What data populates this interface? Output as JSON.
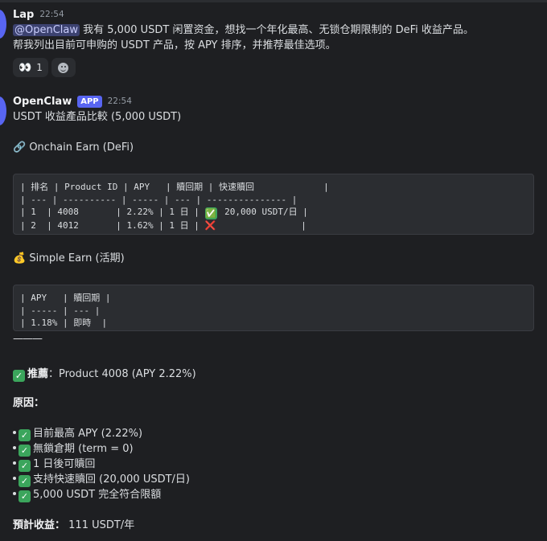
{
  "message1": {
    "author": "Lap",
    "time": "22:54",
    "mention": "@OpenClaw",
    "line1": " 我有 5,000 USDT 闲置资金，想找一个年化最高、无锁仓期限制的 DeFi 收益产品。",
    "line2": "帮我列出目前可申购的 USDT 产品，按 APY 排序，并推荐最佳选项。",
    "reactions": [
      {
        "icon": "eyes-emoji",
        "glyph": "👀",
        "count": "1"
      },
      {
        "icon": "add-reaction-icon"
      }
    ]
  },
  "message2": {
    "author": "OpenClaw",
    "badge": "APP",
    "time": "22:54",
    "heading": "USDT 收益產品比較 (5,000 USDT)",
    "section1": {
      "icon": "link-icon",
      "glyph": "🔗",
      "title": "Onchain Earn (DeFi)"
    },
    "table1": {
      "header": "| 排名 | Product ID | APY   | 贖回期 | 快速贖回             |",
      "sep": "| --- | ---------- | ----- | --- | --------------- |",
      "rows": [
        {
          "left": "| 1  | 4008       | 2.22% | 1 日 | ",
          "mark": "✅",
          "right": " 20,000 USDT/日 |"
        },
        {
          "left": "| 2  | 4012       | 1.62% | 1 日 | ",
          "mark": "❌",
          "right": "                |"
        }
      ]
    },
    "section2": {
      "icon": "money-bag-icon",
      "glyph": "💰",
      "title": "Simple Earn (活期)"
    },
    "table2": {
      "header": "| APY   | 贖回期 |",
      "sep": "| ----- | --- |",
      "row": "| 1.18% | 即時  |"
    },
    "divider": "———",
    "recommend_label": "推薦",
    "recommend_value": "：Product 4008 (APY 2.22%)",
    "reasons_title": "原因：",
    "reasons": [
      "目前最高 APY (2.22%)",
      "無鎖倉期 (term = 0)",
      "1 日後可贖回",
      "支持快速贖回 (20,000 USDT/日)",
      "5,000 USDT 完全符合限額"
    ],
    "estimate_label": "預計收益：",
    "estimate_value": " 111 USDT/年"
  },
  "colors": {
    "background": "#1e1f22",
    "accent": "#5865f2",
    "check": "#3ba55c",
    "cross": "#e0343b"
  }
}
